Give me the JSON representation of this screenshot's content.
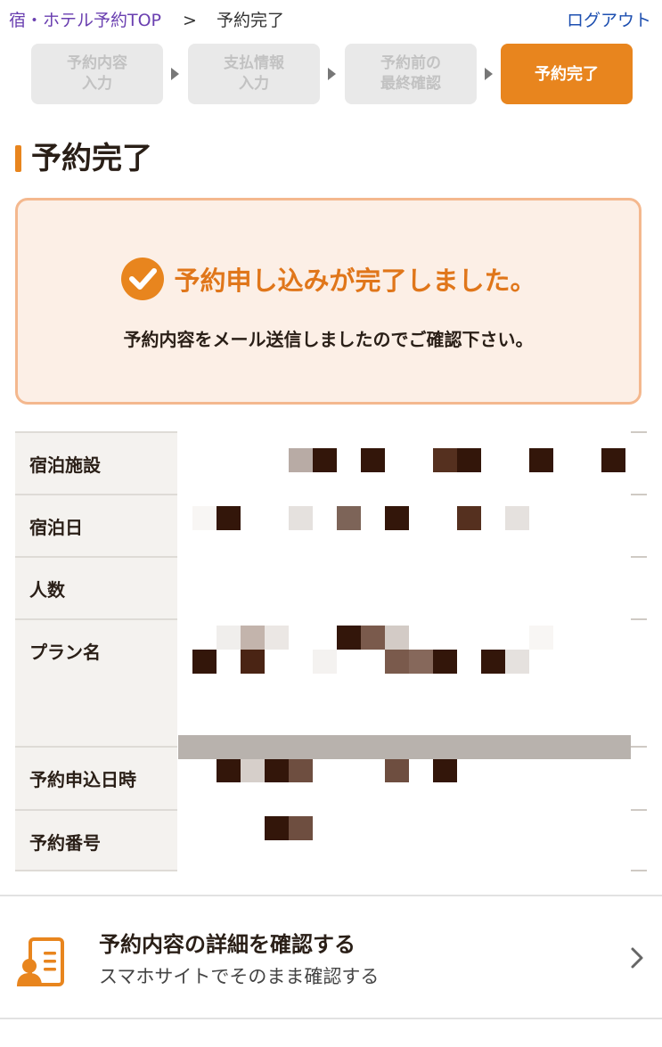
{
  "breadcrumb": {
    "home": "宿・ホテル予約TOP",
    "separator": ">",
    "current": "予約完了"
  },
  "header": {
    "logout_label": "ログアウト"
  },
  "steps": [
    {
      "label": "予約内容\n入力",
      "active": false
    },
    {
      "label": "支払情報\n入力",
      "active": false
    },
    {
      "label": "予約前の\n最終確認",
      "active": false
    },
    {
      "label": "予約完了",
      "active": true
    }
  ],
  "page": {
    "title": "予約完了"
  },
  "completion": {
    "heading": "予約申し込みが完了しました。",
    "message": "予約内容をメール送信しましたのでご確認下さい。"
  },
  "info_table": {
    "rows": [
      {
        "label": "宿泊施設"
      },
      {
        "label": "宿泊日"
      },
      {
        "label": "人数"
      },
      {
        "label": "プラン名"
      },
      {
        "label": "予約申込日時"
      },
      {
        "label": "予約番号"
      }
    ]
  },
  "detail_link": {
    "title": "予約内容の詳細を確認する",
    "subtitle": "スマホサイトでそのまま確認する"
  },
  "colors": {
    "accent": "#e8851e",
    "link": "#1d4fb0",
    "breadcrumb_link": "#6a3fb0",
    "box_border": "#f4b88e",
    "box_bg": "#fcefe6"
  },
  "icons": {
    "check": "check-circle-icon",
    "document": "document-user-icon",
    "chevron": "chevron-right-icon"
  }
}
